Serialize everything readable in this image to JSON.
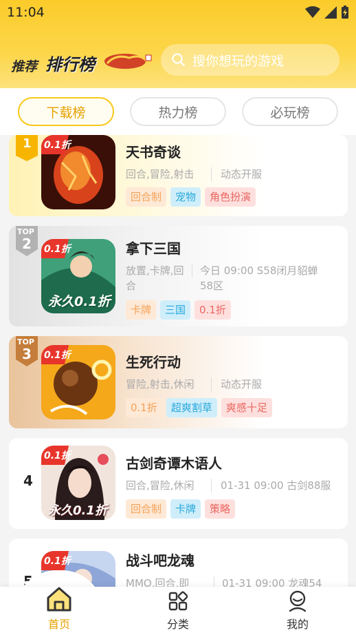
{
  "status": {
    "time": "11:04"
  },
  "top_nav": {
    "tab1": "推荐",
    "tab2": "排行榜"
  },
  "search": {
    "placeholder": "搜你想玩的游戏"
  },
  "subtabs": [
    "下载榜",
    "热力榜",
    "必玩榜"
  ],
  "games": [
    {
      "rank": "1",
      "title": "天书奇谈",
      "meta": "回合,冒险,射击",
      "server": "动态开服",
      "discount": "0.1折",
      "tags": [
        {
          "t": "回合制",
          "c": "orange"
        },
        {
          "t": "宠物",
          "c": "blue"
        },
        {
          "t": "角色扮演",
          "c": "red"
        }
      ]
    },
    {
      "rank": "2",
      "rank_prefix": "TOP",
      "title": "拿下三国",
      "meta": "放置,卡牌,回合",
      "server": "今日 09:00 S58闭月貂蝉58区",
      "discount": "0.1折",
      "icon_text": "永久0.1折",
      "tags": [
        {
          "t": "卡牌",
          "c": "orange"
        },
        {
          "t": "三国",
          "c": "blue"
        },
        {
          "t": "0.1折",
          "c": "red"
        }
      ]
    },
    {
      "rank": "3",
      "rank_prefix": "TOP",
      "title": "生死行动",
      "meta": "冒险,射击,休闲",
      "server": "动态开服",
      "discount": "0.1折",
      "tags": [
        {
          "t": "0.1折",
          "c": "orange"
        },
        {
          "t": "超爽割草",
          "c": "blue"
        },
        {
          "t": "爽感十足",
          "c": "red"
        }
      ]
    },
    {
      "rank": "4",
      "title": "古剑奇谭木语人",
      "meta": "回合,冒险,休闲",
      "server": "01-31 09:00 古剑88服",
      "discount": "0.1折",
      "icon_text": "永久0.1折",
      "tags": [
        {
          "t": "回合制",
          "c": "orange"
        },
        {
          "t": "卡牌",
          "c": "blue"
        },
        {
          "t": "策略",
          "c": "red"
        }
      ]
    },
    {
      "rank": "5",
      "title": "战斗吧龙魂",
      "meta": "MMO,回合,即",
      "server": "01-31 09:00 龙魂54",
      "discount": "0.1折"
    }
  ],
  "bottom_nav": [
    {
      "label": "首页",
      "active": true
    },
    {
      "label": "分类"
    },
    {
      "label": "我的"
    }
  ]
}
